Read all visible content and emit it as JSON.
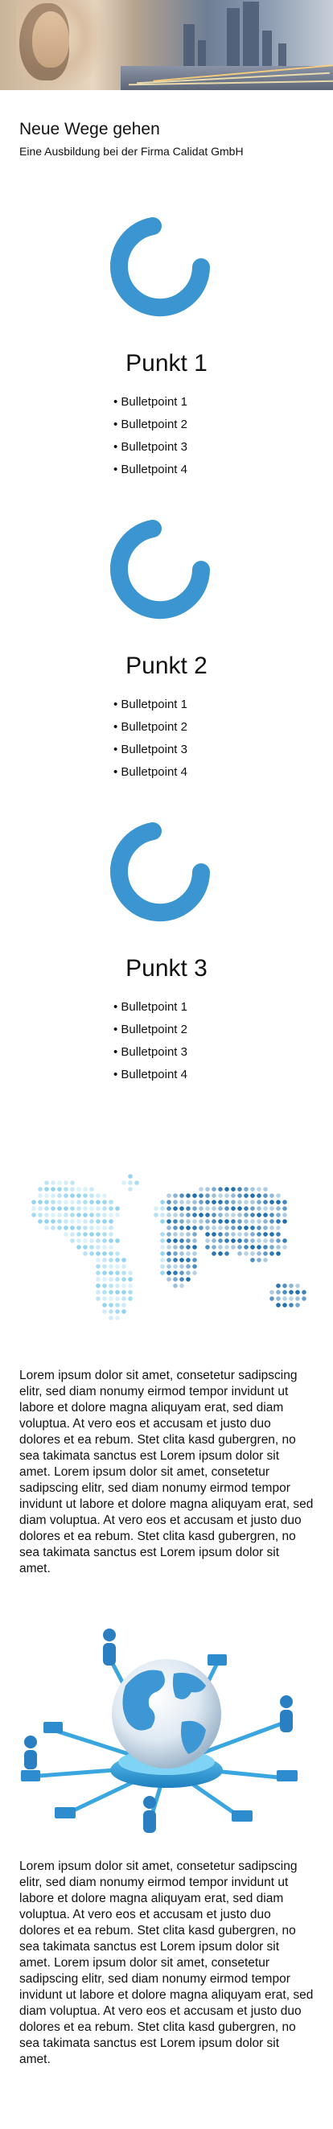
{
  "intro": {
    "title": "Neue Wege gehen",
    "subtitle": "Eine Ausbildung bei der Firma Calidat GmbH"
  },
  "points": [
    {
      "title": "Punkt 1",
      "bullets": [
        "Bulletpoint 1",
        "Bulletpoint 2",
        "Bulletpoint 3",
        "Bulletpoint 4"
      ]
    },
    {
      "title": "Punkt 2",
      "bullets": [
        "Bulletpoint 1",
        "Bulletpoint 2",
        "Bulletpoint 3",
        "Bulletpoint 4"
      ]
    },
    {
      "title": "Punkt 3",
      "bullets": [
        "Bulletpoint 1",
        "Bulletpoint 2",
        "Bulletpoint 3",
        "Bulletpoint 4"
      ]
    }
  ],
  "paragraphs": [
    "Lorem ipsum dolor sit amet, consetetur sadipscing elitr, sed diam nonumy eirmod tempor invidunt ut labore et dolore magna aliquyam erat, sed diam voluptua. At vero eos et accusam et justo duo dolores et ea rebum. Stet clita kasd gubergren, no sea takimata sanctus est Lorem ipsum dolor sit amet. Lorem ipsum dolor sit amet, consetetur sadipscing elitr, sed diam nonumy eirmod tempor invidunt ut labore et dolore magna aliquyam erat, sed diam voluptua. At vero eos et accusam et justo duo dolores et ea rebum. Stet clita kasd gubergren, no sea takimata sanctus est Lorem ipsum dolor sit amet.",
    "Lorem ipsum dolor sit amet, consetetur sadipscing elitr, sed diam nonumy eirmod tempor invidunt ut labore et dolore magna aliquyam erat, sed diam voluptua. At vero eos et accusam et justo duo dolores et ea rebum. Stet clita kasd gubergren, no sea takimata sanctus est Lorem ipsum dolor sit amet. Lorem ipsum dolor sit amet, consetetur sadipscing elitr, sed diam nonumy eirmod tempor invidunt ut labore et dolore magna aliquyam erat, sed diam voluptua. At vero eos et accusam et justo duo dolores et ea rebum. Stet clita kasd gubergren, no sea takimata sanctus est Lorem ipsum dolor sit amet."
  ],
  "colors": {
    "accent": "#3a95d1",
    "map_light": "#8fd3f0",
    "map_dark": "#1f6fae"
  },
  "images": {
    "hero": "city-traffic-hero-image",
    "progress_ring": "progress-ring-icon",
    "world_map": "dotted-world-map",
    "network": "globe-network-illustration"
  }
}
